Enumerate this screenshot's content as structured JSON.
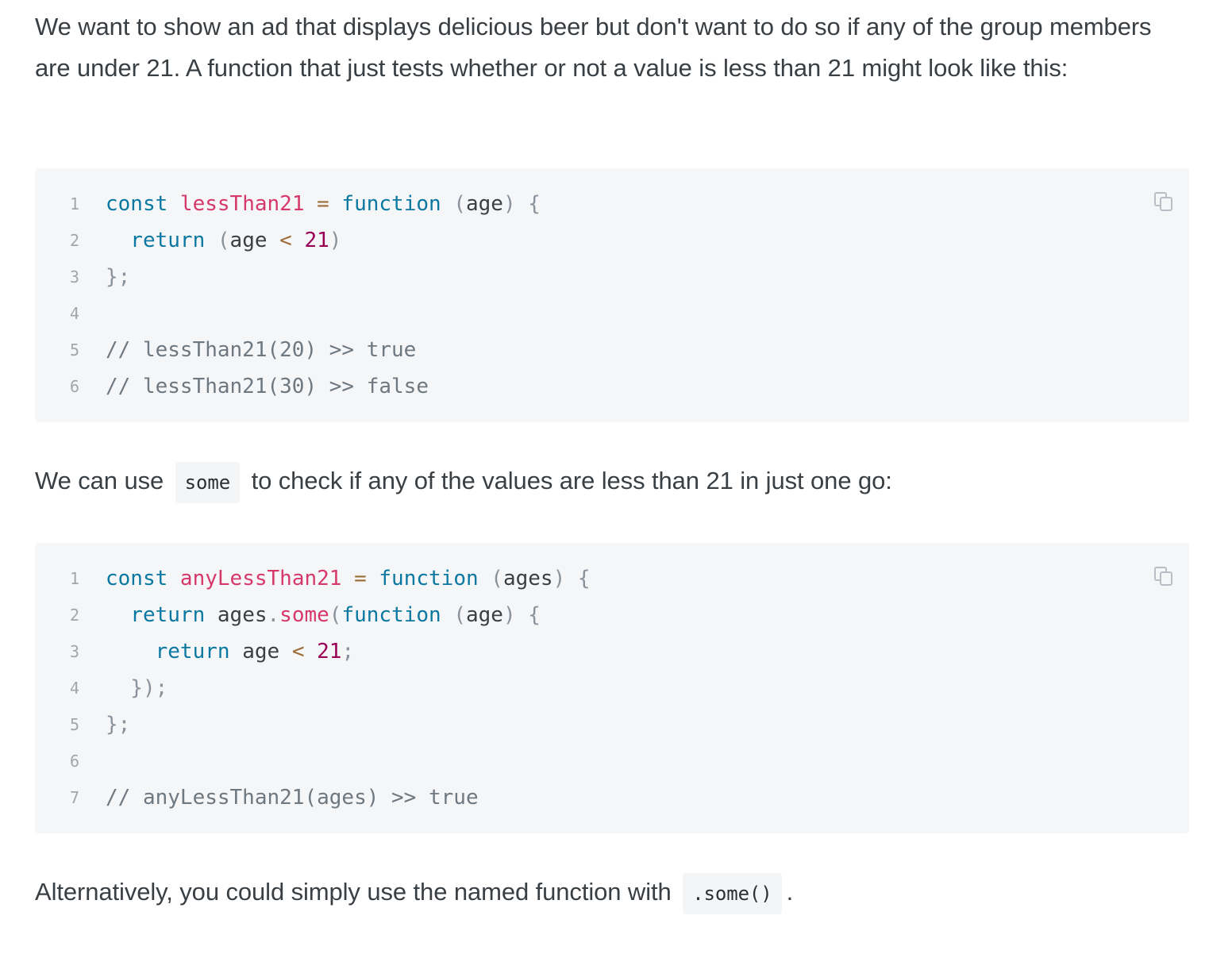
{
  "paragraphs": {
    "intro": "We want to show an ad that displays delicious beer but don't want to do so if any of the group members are under 21. A function that just tests whether or not a value is less than 21 might look like this:",
    "some_before": "We can use",
    "some_code": "some",
    "some_after": "to check if any of the values are less than 21 in just one go:",
    "alt_before": "Alternatively, you could simply use the named function with",
    "alt_code": ".some()",
    "alt_after": "."
  },
  "code_blocks": [
    {
      "copy_icon": "copy-icon",
      "lines": [
        {
          "n": "1",
          "tokens": [
            [
              "kw",
              "const"
            ],
            [
              "",
              ""
            ],
            [
              "fn",
              " lessThan21"
            ],
            [
              "op",
              " ="
            ],
            [
              "kw",
              " function"
            ],
            [
              "punc",
              " ("
            ],
            [
              "",
              "age"
            ],
            [
              "punc",
              ")"
            ],
            [
              "punc",
              " {"
            ]
          ]
        },
        {
          "n": "2",
          "tokens": [
            [
              "kw",
              "  return"
            ],
            [
              "punc",
              " ("
            ],
            [
              "",
              "age"
            ],
            [
              "op",
              " <"
            ],
            [
              "num",
              " 21"
            ],
            [
              "punc",
              ")"
            ]
          ]
        },
        {
          "n": "3",
          "tokens": [
            [
              "punc",
              "};"
            ]
          ]
        },
        {
          "n": "4",
          "tokens": []
        },
        {
          "n": "5",
          "tokens": [
            [
              "cm",
              "// lessThan21(20) >> true"
            ]
          ]
        },
        {
          "n": "6",
          "tokens": [
            [
              "cm",
              "// lessThan21(30) >> false"
            ]
          ]
        }
      ]
    },
    {
      "copy_icon": "copy-icon",
      "lines": [
        {
          "n": "1",
          "tokens": [
            [
              "kw",
              "const"
            ],
            [
              "fn",
              " anyLessThan21"
            ],
            [
              "op",
              " ="
            ],
            [
              "kw",
              " function"
            ],
            [
              "punc",
              " ("
            ],
            [
              "",
              "ages"
            ],
            [
              "punc",
              ")"
            ],
            [
              "punc",
              " {"
            ]
          ]
        },
        {
          "n": "2",
          "tokens": [
            [
              "kw",
              "  return"
            ],
            [
              "",
              " ages"
            ],
            [
              "punc",
              "."
            ],
            [
              "fn",
              "some"
            ],
            [
              "punc",
              "("
            ],
            [
              "kw",
              "function"
            ],
            [
              "punc",
              " ("
            ],
            [
              "",
              "age"
            ],
            [
              "punc",
              ")"
            ],
            [
              "punc",
              " {"
            ]
          ]
        },
        {
          "n": "3",
          "tokens": [
            [
              "kw",
              "    return"
            ],
            [
              "",
              " age"
            ],
            [
              "op",
              " <"
            ],
            [
              "num",
              " 21"
            ],
            [
              "punc",
              ";"
            ]
          ]
        },
        {
          "n": "4",
          "tokens": [
            [
              "punc",
              "  });"
            ]
          ]
        },
        {
          "n": "5",
          "tokens": [
            [
              "punc",
              "};"
            ]
          ]
        },
        {
          "n": "6",
          "tokens": []
        },
        {
          "n": "7",
          "tokens": [
            [
              "cm",
              "// anyLessThan21(ages) >> true"
            ]
          ]
        }
      ]
    }
  ]
}
